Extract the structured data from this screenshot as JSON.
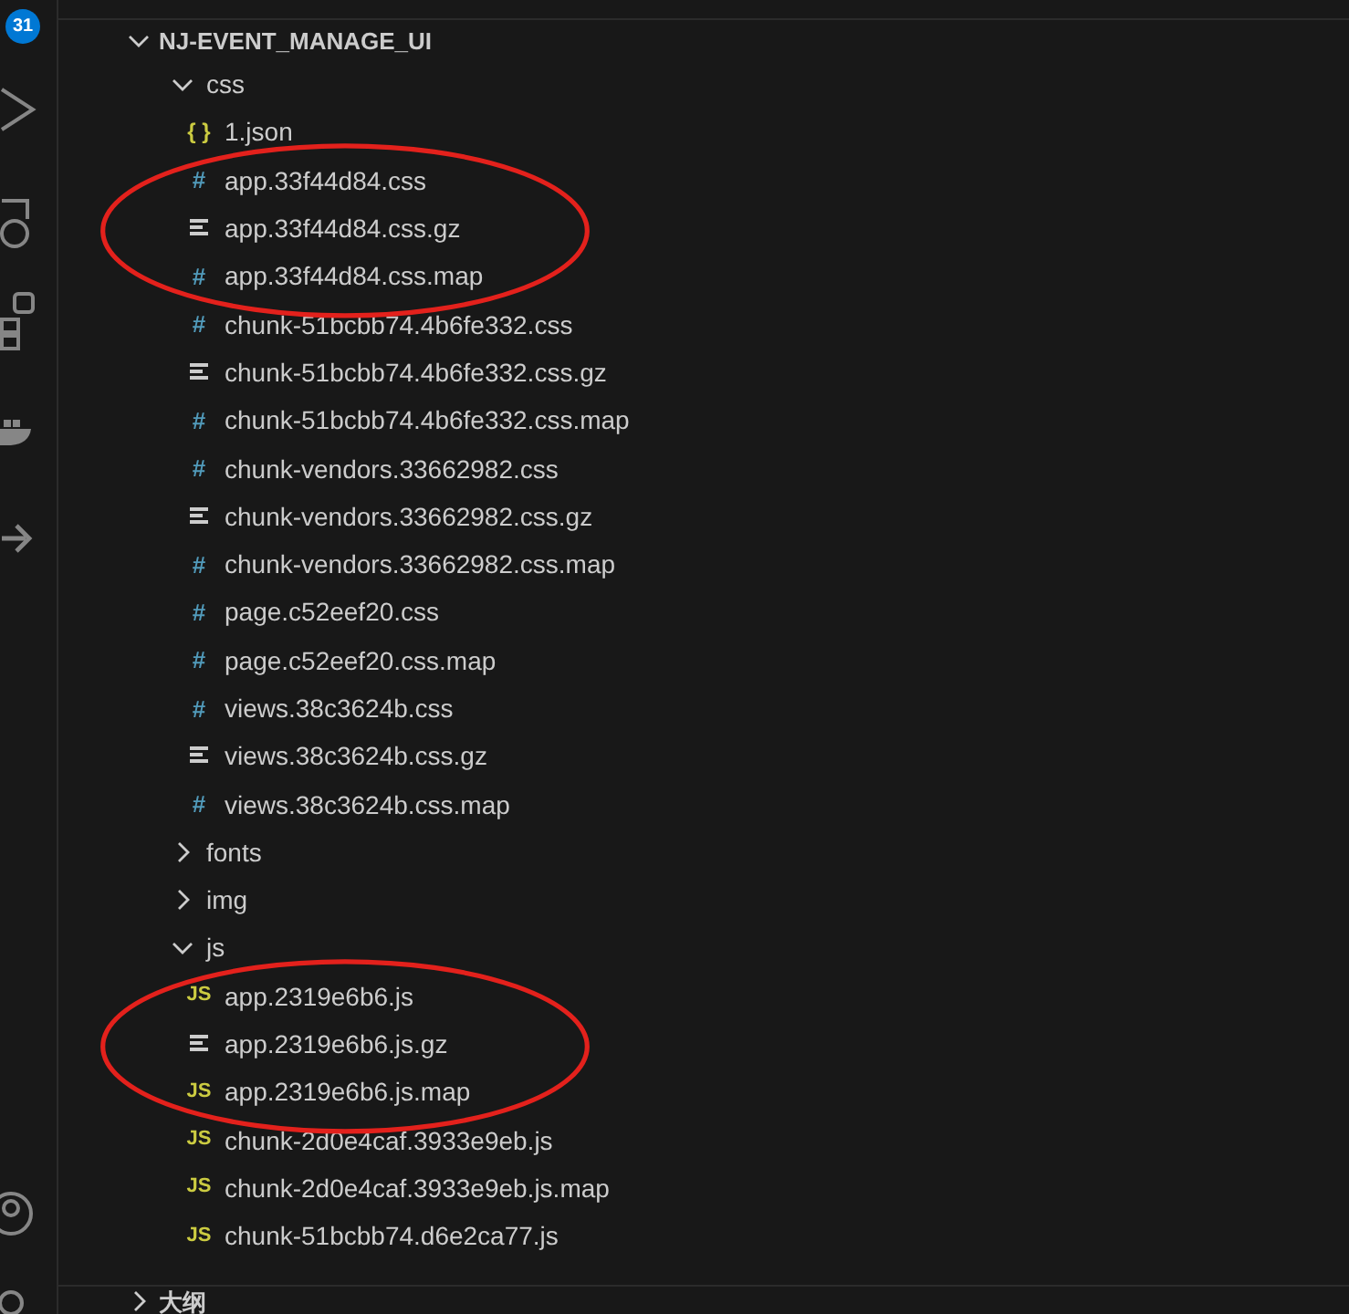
{
  "activity_bar": {
    "badge": "31"
  },
  "section": {
    "title": "NJ-EVENT_MANAGE_UI",
    "expanded": true
  },
  "tree": [
    {
      "name": "css",
      "kind": "folder",
      "expanded": true,
      "children": [
        {
          "name": "1.json",
          "kind": "json",
          "icon": "{ }",
          "circled": false
        },
        {
          "name": "app.33f44d84.css",
          "kind": "css",
          "icon": "#",
          "circled": true
        },
        {
          "name": "app.33f44d84.css.gz",
          "kind": "text",
          "circled": true
        },
        {
          "name": "app.33f44d84.css.map",
          "kind": "css",
          "icon": "#",
          "circled": true
        },
        {
          "name": "chunk-51bcbb74.4b6fe332.css",
          "kind": "css",
          "icon": "#",
          "circled": false
        },
        {
          "name": "chunk-51bcbb74.4b6fe332.css.gz",
          "kind": "text",
          "circled": false
        },
        {
          "name": "chunk-51bcbb74.4b6fe332.css.map",
          "kind": "css",
          "icon": "#",
          "circled": false
        },
        {
          "name": "chunk-vendors.33662982.css",
          "kind": "css",
          "icon": "#",
          "circled": false
        },
        {
          "name": "chunk-vendors.33662982.css.gz",
          "kind": "text",
          "circled": false
        },
        {
          "name": "chunk-vendors.33662982.css.map",
          "kind": "css",
          "icon": "#",
          "circled": false
        },
        {
          "name": "page.c52eef20.css",
          "kind": "css",
          "icon": "#",
          "circled": false
        },
        {
          "name": "page.c52eef20.css.map",
          "kind": "css",
          "icon": "#",
          "circled": false
        },
        {
          "name": "views.38c3624b.css",
          "kind": "css",
          "icon": "#",
          "circled": false
        },
        {
          "name": "views.38c3624b.css.gz",
          "kind": "text",
          "circled": false
        },
        {
          "name": "views.38c3624b.css.map",
          "kind": "css",
          "icon": "#",
          "circled": false
        }
      ]
    },
    {
      "name": "fonts",
      "kind": "folder",
      "expanded": false
    },
    {
      "name": "img",
      "kind": "folder",
      "expanded": false
    },
    {
      "name": "js",
      "kind": "folder",
      "expanded": true,
      "children": [
        {
          "name": "app.2319e6b6.js",
          "kind": "js",
          "icon": "JS",
          "circled": true
        },
        {
          "name": "app.2319e6b6.js.gz",
          "kind": "text",
          "circled": true
        },
        {
          "name": "app.2319e6b6.js.map",
          "kind": "js",
          "icon": "JS",
          "circled": true
        },
        {
          "name": "chunk-2d0e4caf.3933e9eb.js",
          "kind": "js",
          "icon": "JS",
          "circled": false
        },
        {
          "name": "chunk-2d0e4caf.3933e9eb.js.map",
          "kind": "js",
          "icon": "JS",
          "circled": false
        },
        {
          "name": "chunk-51bcbb74.d6e2ca77.js",
          "kind": "js",
          "icon": "JS",
          "circled": false
        }
      ]
    }
  ],
  "outline": {
    "title": "大纲",
    "expanded": false
  }
}
